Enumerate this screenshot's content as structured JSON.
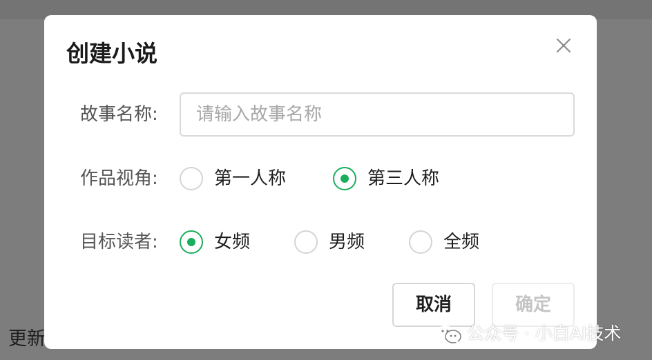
{
  "background": {
    "partial_text": "更新"
  },
  "dialog": {
    "title": "创建小说",
    "close_icon": "close-icon",
    "story_name": {
      "label": "故事名称:",
      "value": "",
      "placeholder": "请输入故事名称"
    },
    "perspective": {
      "label": "作品视角:",
      "options": [
        {
          "label": "第一人称",
          "checked": false
        },
        {
          "label": "第三人称",
          "checked": true
        }
      ]
    },
    "audience": {
      "label": "目标读者:",
      "options": [
        {
          "label": "女频",
          "checked": true
        },
        {
          "label": "男频",
          "checked": false
        },
        {
          "label": "全频",
          "checked": false
        }
      ]
    },
    "buttons": {
      "cancel": "取消",
      "confirm": "确定"
    }
  },
  "watermark": {
    "icon": "wechat-icon",
    "text": "公众号 · 小白AI技术"
  },
  "colors": {
    "accent": "#1aad5c",
    "overlay": "#7d7d7d",
    "disabled_text": "#c4c4c4"
  }
}
